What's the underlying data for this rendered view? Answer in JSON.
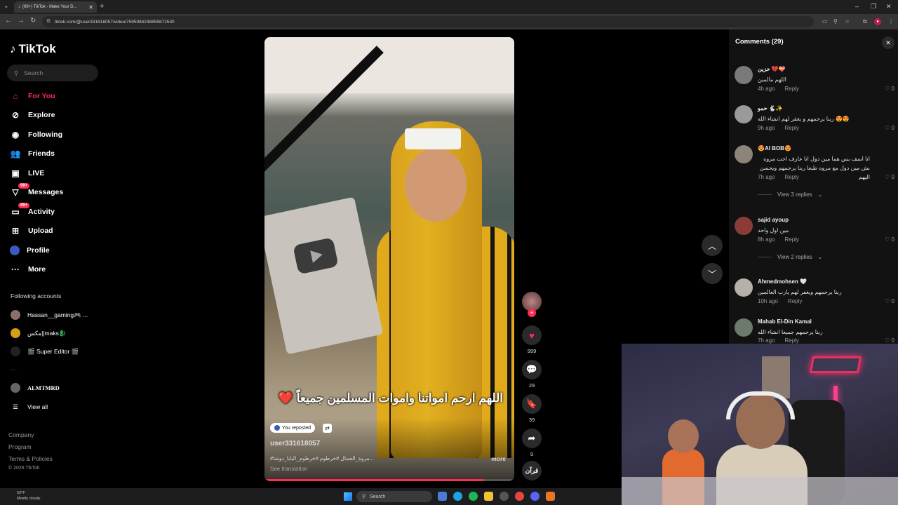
{
  "browser": {
    "tab_title": "(99+) TikTok - Make Your D...",
    "url": "tiktok.com/@user331618057/video/7595984248859872530",
    "new_tab": "+",
    "minimize": "–",
    "maximize": "❐",
    "close": "✕"
  },
  "sidebar": {
    "logo": "TikTok",
    "search_placeholder": "Search",
    "nav": [
      {
        "label": "For You",
        "icon": "home-icon",
        "active": true
      },
      {
        "label": "Explore",
        "icon": "compass-icon"
      },
      {
        "label": "Following",
        "icon": "following-icon"
      },
      {
        "label": "Friends",
        "icon": "friends-icon"
      },
      {
        "label": "LIVE",
        "icon": "live-icon"
      },
      {
        "label": "Messages",
        "icon": "messages-icon",
        "badge": "99+"
      },
      {
        "label": "Activity",
        "icon": "activity-icon",
        "badge": "99+"
      },
      {
        "label": "Upload",
        "icon": "upload-icon"
      },
      {
        "label": "Profile",
        "icon": "profile-icon"
      },
      {
        "label": "More",
        "icon": "more-icon"
      }
    ],
    "following_title": "Following accounts",
    "accounts": [
      "Hassan__gaming🎮 ...",
      "مكس||maks🐉",
      "🎬 Super Editor 🎬",
      ".",
      "ALMTMRD"
    ],
    "view_all": "View all",
    "footer": [
      "Company",
      "Program",
      "Terms & Policies",
      "© 2026 TikTok"
    ]
  },
  "video": {
    "caption_overlay": "اللهم ارحم امواتنا واموات المسلمين جميعاً ❤️",
    "repost_label": "You reposted",
    "author": "user331618057",
    "hashtags": "#مروة_الجمال #خرطوم #خرطوم_اليابا_دوشا...",
    "more": "more",
    "see_translation": "See translation",
    "progress_fraction": 0.88
  },
  "actions": {
    "likes": "999",
    "comments": "29",
    "saves": "39",
    "shares": "9",
    "sound_label": "قرآن"
  },
  "comments": {
    "title": "Comments (29)",
    "items": [
      {
        "name": "حزين 💔💝",
        "text": "اللهم مالمين",
        "time": "4h ago",
        "reply": "Reply",
        "likes": "0"
      },
      {
        "name": "حمو 🐇✨",
        "text": "ربنا يرحمهم و يغفر لهم انشاء الله 😍😍",
        "time": "9h ago",
        "reply": "Reply",
        "likes": "0"
      },
      {
        "name": "😍Al BOB😍",
        "text": "انا اسف بس هما مين دول انا عارف احت مروه بش مين دول مع مروه طبعا ربنا يرحمهم ويحسن اليهم",
        "time": "7h ago",
        "reply": "Reply",
        "likes": "0",
        "view_replies": "View 3 replies"
      },
      {
        "name": "sajid ayoup",
        "text": "مين اول واحد",
        "time": "8h ago",
        "reply": "Reply",
        "likes": "0",
        "view_replies": "View 2 replies"
      },
      {
        "name": "Ahmedmohsen 🤍",
        "text": "ربنا يرحمهم ويغفر لهم يارب العالمين",
        "time": "10h ago",
        "reply": "Reply",
        "likes": "0"
      },
      {
        "name": "Mahab El-Din Kamal",
        "text": "ربنا يرحمهم جميعا انشاء الله",
        "time": "7h ago",
        "reply": "Reply",
        "likes": "0"
      }
    ]
  },
  "taskbar": {
    "weather_temp": "53°F",
    "weather_desc": "Mostly cloudy",
    "search": "Search"
  },
  "colors": {
    "accent": "#fe2c55",
    "bg": "#000000",
    "panel": "#121212"
  }
}
